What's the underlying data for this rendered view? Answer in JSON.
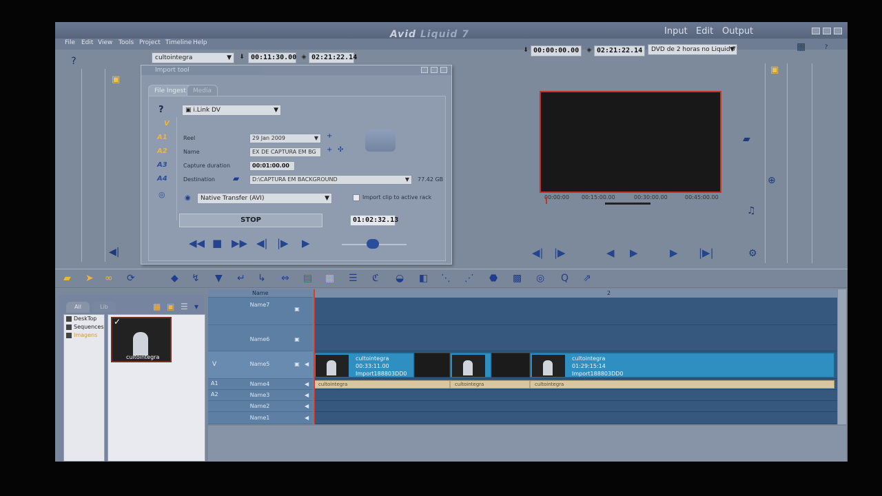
{
  "window": {
    "brand_a": "Avid",
    "brand_b": "Liquid 7",
    "modes": [
      "Input",
      "Edit",
      "Output"
    ]
  },
  "menu": [
    "File",
    "Edit",
    "View",
    "Tools",
    "Project",
    "Timeline",
    "Help"
  ],
  "left_toolbar": {
    "clip_combo": "cultointegra",
    "timecode_in": "00:11:30.00",
    "timecode_dur": "02:21:22.14"
  },
  "right_toolbar": {
    "timecode_in": "00:00:00.00",
    "timecode_dur": "02:21:22.14",
    "output_combo": "DVD de 2 horas no Liquid 7"
  },
  "dialog": {
    "title": "Import tool",
    "tabs": [
      "File Ingest",
      "Media"
    ],
    "device": "i.Link DV",
    "tracks": [
      "V",
      "A1",
      "A2",
      "A3",
      "A4"
    ],
    "reel_label": "Reel",
    "reel_value": "29 Jan 2009",
    "name_label": "Name",
    "name_value": "EX DE CAPTURA EM BG",
    "capture_label": "Capture duration",
    "capture_value": "00:01:00.00",
    "destination_label": "Destination",
    "destination_value": "D:\\CAPTURA EM BACKGROUND",
    "destination_free": "77.42 GB",
    "transfer_value": "Native Transfer (AVI)",
    "import_checkbox_label": "Import clip to active rack",
    "stop_label": "STOP",
    "elapsed": "01:02:32.13"
  },
  "preview": {
    "ruler": [
      "00:00:00",
      "00:15:00.00",
      "00:30:00.00",
      "00:45:00.00"
    ]
  },
  "bin": {
    "tabs": [
      "All",
      "Lib"
    ],
    "tree": [
      "DeskTop",
      "Sequences",
      "Imagens"
    ],
    "thumb_label": "cultointegra"
  },
  "timeline": {
    "header_name": "Name",
    "ruler_mark": "2",
    "tracks": [
      "Name7",
      "Name6",
      "Name5",
      "Name4",
      "Name3",
      "Name2",
      "Name1"
    ],
    "track_tags": [
      "V",
      "A1",
      "A2"
    ],
    "clip1": {
      "name": "cultointegra",
      "tc": "00:33:11.00",
      "id": "Import188803DD0"
    },
    "clip2": {
      "name": "cultointegra",
      "tc": "01:29:15:14",
      "id": "Import188803DD0"
    },
    "audio_label": "cultointegra"
  },
  "colors": {
    "accent_red": "#c73320",
    "track_blue": "#36587e",
    "clip_blue": "#2f8fc0",
    "icon_yellow": "#f2c24a"
  }
}
